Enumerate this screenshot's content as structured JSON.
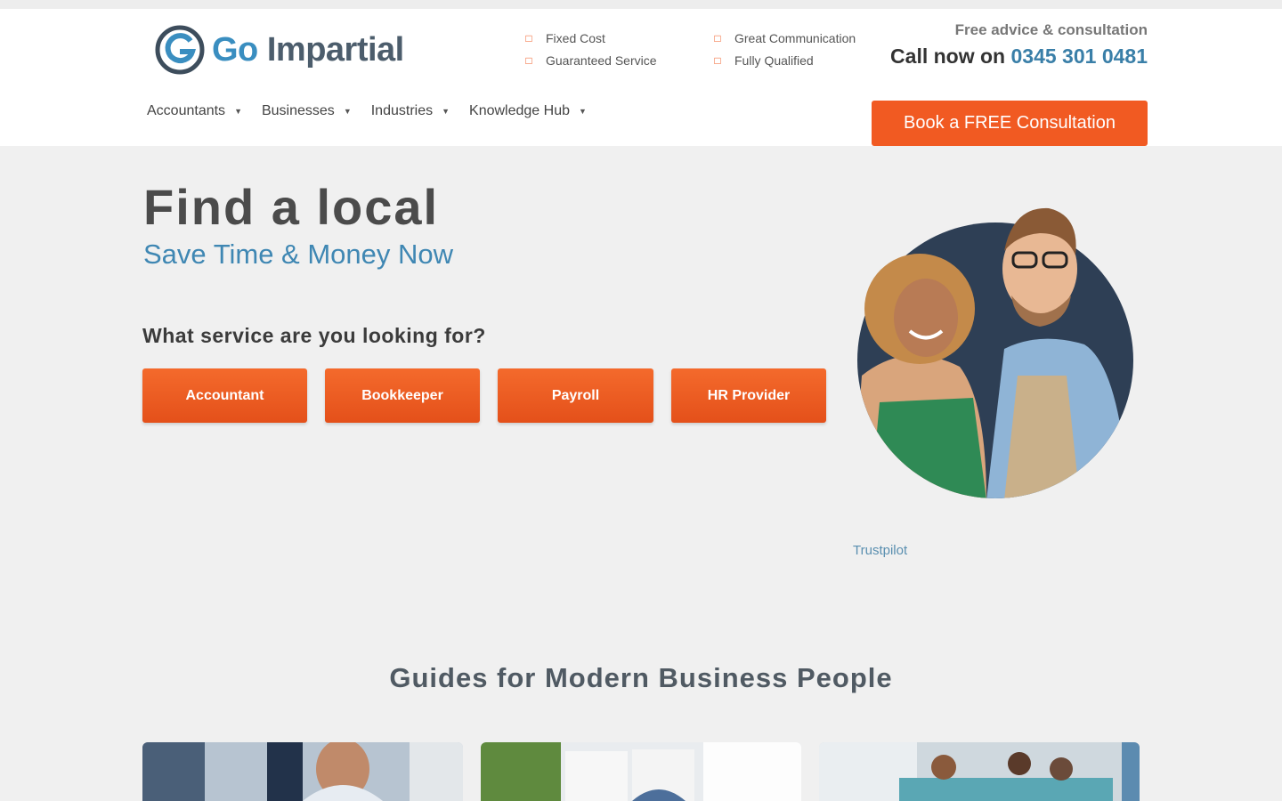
{
  "brand": {
    "go": "Go",
    "impartial": "Impartial"
  },
  "features": {
    "col1": [
      "Fixed Cost",
      "Guaranteed Service"
    ],
    "col2": [
      "Great Communication",
      "Fully Qualified"
    ]
  },
  "contact": {
    "advice": "Free advice & consultation",
    "call_prefix": "Call now on",
    "phone": "0345 301 0481"
  },
  "nav": {
    "items": [
      {
        "label": "Accountants"
      },
      {
        "label": "Businesses"
      },
      {
        "label": "Industries"
      },
      {
        "label": "Knowledge Hub"
      }
    ]
  },
  "cta": {
    "label": "Book a FREE Consultation"
  },
  "hero": {
    "title": "Find a local",
    "subtitle": "Save Time & Money Now",
    "question": "What service are you looking for?",
    "services": [
      "Accountant",
      "Bookkeeper",
      "Payroll",
      "HR Provider"
    ]
  },
  "trustpilot": {
    "label": "Trustpilot"
  },
  "guides": {
    "title": "Guides for Modern Business People"
  },
  "colors": {
    "accent": "#f15a22",
    "brand_blue": "#3a8ec0",
    "brand_grey": "#4c5d6c"
  }
}
